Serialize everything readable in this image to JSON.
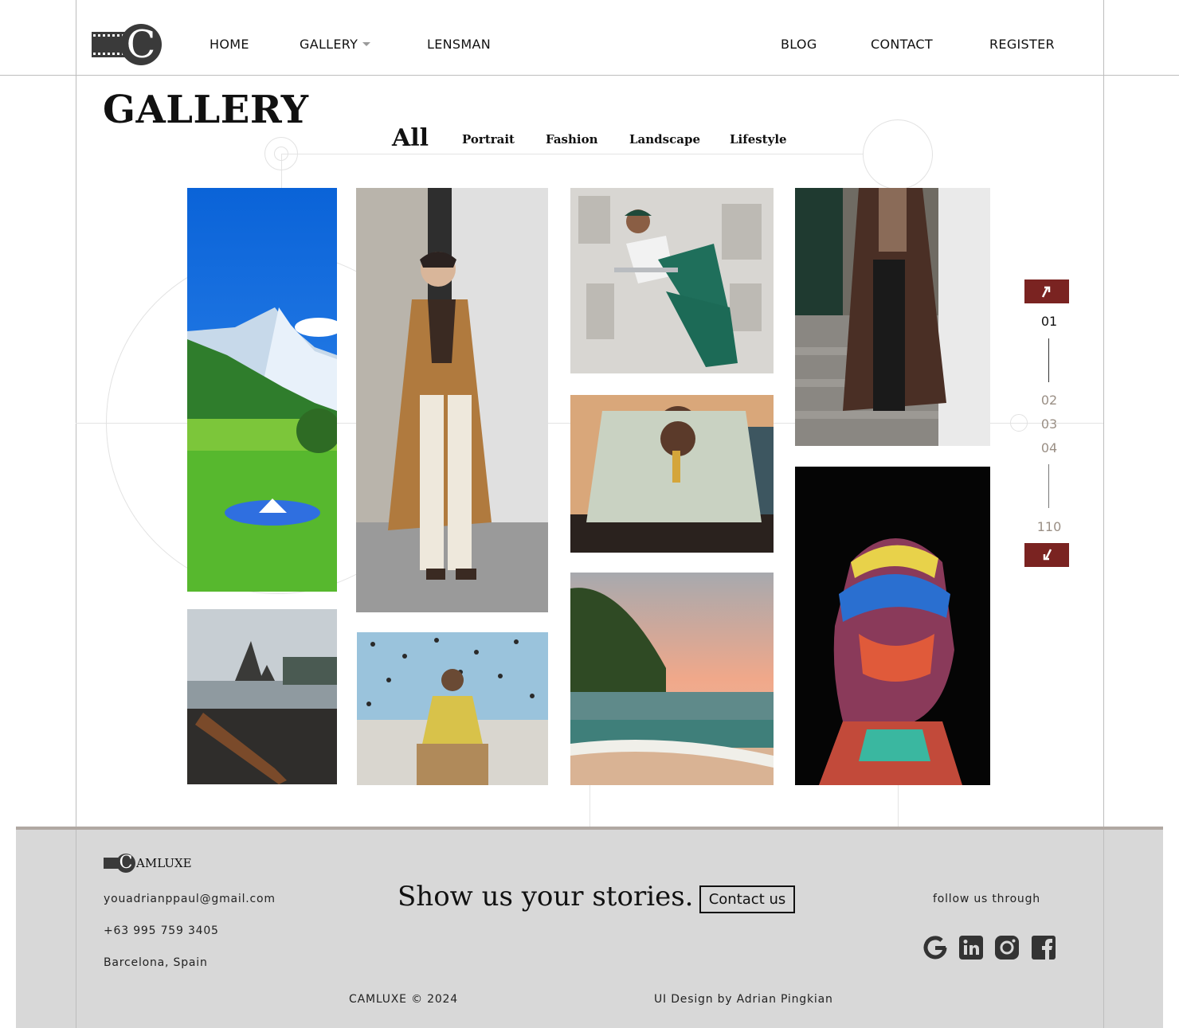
{
  "brand": {
    "logo_letter": "C",
    "name": "CAMLUXE"
  },
  "nav": {
    "home": "HOME",
    "gallery": "GALLERY",
    "lensman": "LENSMAN",
    "blog": "BLOG",
    "contact": "CONTACT",
    "register": "REGISTER"
  },
  "gallery": {
    "title": "GALLERY",
    "tabs": [
      "All",
      "Portrait",
      "Fashion",
      "Landscape",
      "Lifestyle"
    ],
    "active_tab": "All"
  },
  "pager": {
    "up_icon": "arrow-up-icon",
    "down_icon": "arrow-down-icon",
    "current": "01",
    "pages": [
      "02",
      "03",
      "04"
    ],
    "last": "110",
    "accent": "#7a2321"
  },
  "footer": {
    "email": "youadrianppaul@gmail.com",
    "phone": "+63 995 759 3405",
    "location": "Barcelona, Spain",
    "tagline": "Show us your stories.",
    "contact_button": "Contact us",
    "follow_text": "follow us  through",
    "social_icons": [
      "google-icon",
      "linkedin-icon",
      "instagram-icon",
      "facebook-icon"
    ],
    "copyright": "CAMLUXE © 2024",
    "credit": "UI Design by Adrian Pingkian"
  }
}
